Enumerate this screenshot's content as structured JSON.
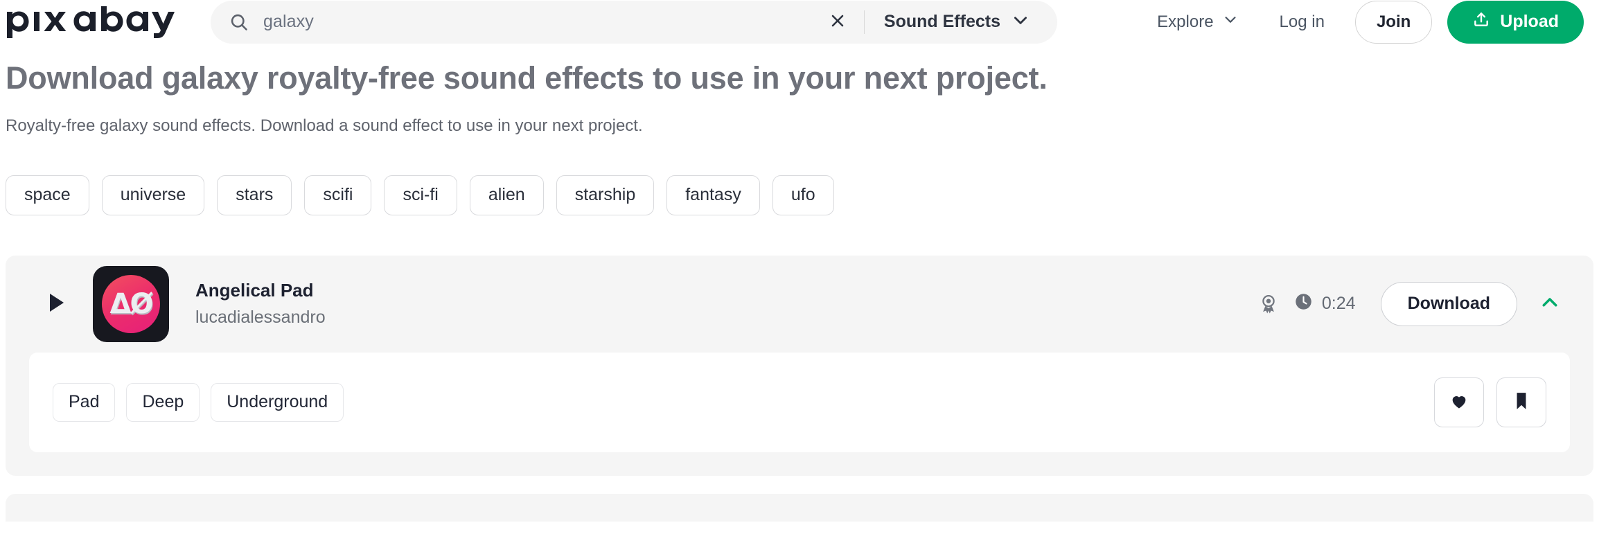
{
  "brand": {
    "name": "pixabay",
    "accent_green": "#00ab6b"
  },
  "header": {
    "search": {
      "value": "galaxy",
      "placeholder": "Search sound effects",
      "icon": "search-icon"
    },
    "clear_icon": "close-icon",
    "media_type": {
      "label": "Sound Effects",
      "icon": "chevron-down-icon"
    },
    "nav": {
      "explore": {
        "label": "Explore",
        "icon": "chevron-down-icon"
      },
      "login": {
        "label": "Log in"
      },
      "join": {
        "label": "Join"
      },
      "upload": {
        "label": "Upload",
        "icon": "upload-icon"
      }
    }
  },
  "main": {
    "title": "Download galaxy royalty-free sound effects to use in your next project.",
    "subtitle": "Royalty-free galaxy sound effects. Download a sound effect to use in your next project.",
    "related_tags": [
      "space",
      "universe",
      "stars",
      "scifi",
      "sci-fi",
      "alien",
      "starship",
      "fantasy",
      "ufo"
    ]
  },
  "results": [
    {
      "play_icon": "play-icon",
      "cover_glyph": "ΔØ",
      "title": "Angelical Pad",
      "artist": "lucadialessandro",
      "award_icon": "award-ribbon-icon",
      "clock_icon": "clock-icon",
      "duration": "0:24",
      "download_label": "Download",
      "collapse_icon": "chevron-up-icon",
      "detail_tags": [
        "Pad",
        "Deep",
        "Underground"
      ],
      "like_icon": "heart-icon",
      "save_icon": "bookmark-icon"
    }
  ]
}
